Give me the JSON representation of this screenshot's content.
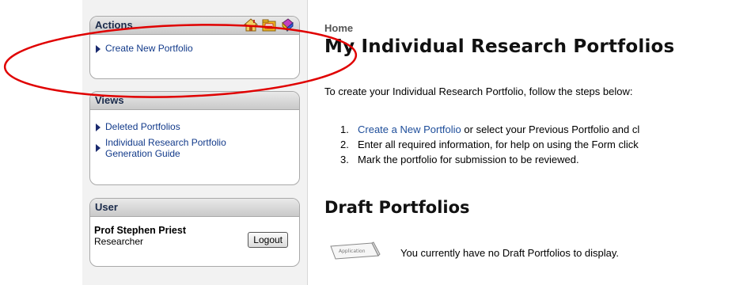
{
  "sidebar": {
    "actions": {
      "title": "Actions",
      "items": [
        {
          "label": "Create New Portfolio"
        }
      ]
    },
    "views": {
      "title": "Views",
      "items": [
        {
          "label": "Deleted Portfolios"
        },
        {
          "label": "Individual Research Portfolio Generation Guide"
        }
      ]
    },
    "user": {
      "title": "User",
      "name": "Prof Stephen Priest",
      "role": "Researcher",
      "logout_label": "Logout"
    },
    "header_icons": [
      "home-icon",
      "folder-icon",
      "book-icon"
    ]
  },
  "main": {
    "breadcrumb": "Home",
    "title": "My Individual Research Portfolios",
    "intro": "To create your Individual Research Portfolio, follow the steps below:",
    "steps": [
      {
        "num": "1.",
        "link": "Create a New Portfolio",
        "text": " or select your Previous Portfolio and cl"
      },
      {
        "num": "2.",
        "text": "Enter all required information, for help on using the Form click"
      },
      {
        "num": "3.",
        "text": "Mark the portfolio for submission to be reviewed."
      }
    ],
    "draft_title": "Draft Portfolios",
    "draft_empty": "You currently have no Draft Portfolios to display.",
    "stamp_text": "Application"
  },
  "colors": {
    "annotation": "#e00000",
    "link": "#123a8a"
  }
}
